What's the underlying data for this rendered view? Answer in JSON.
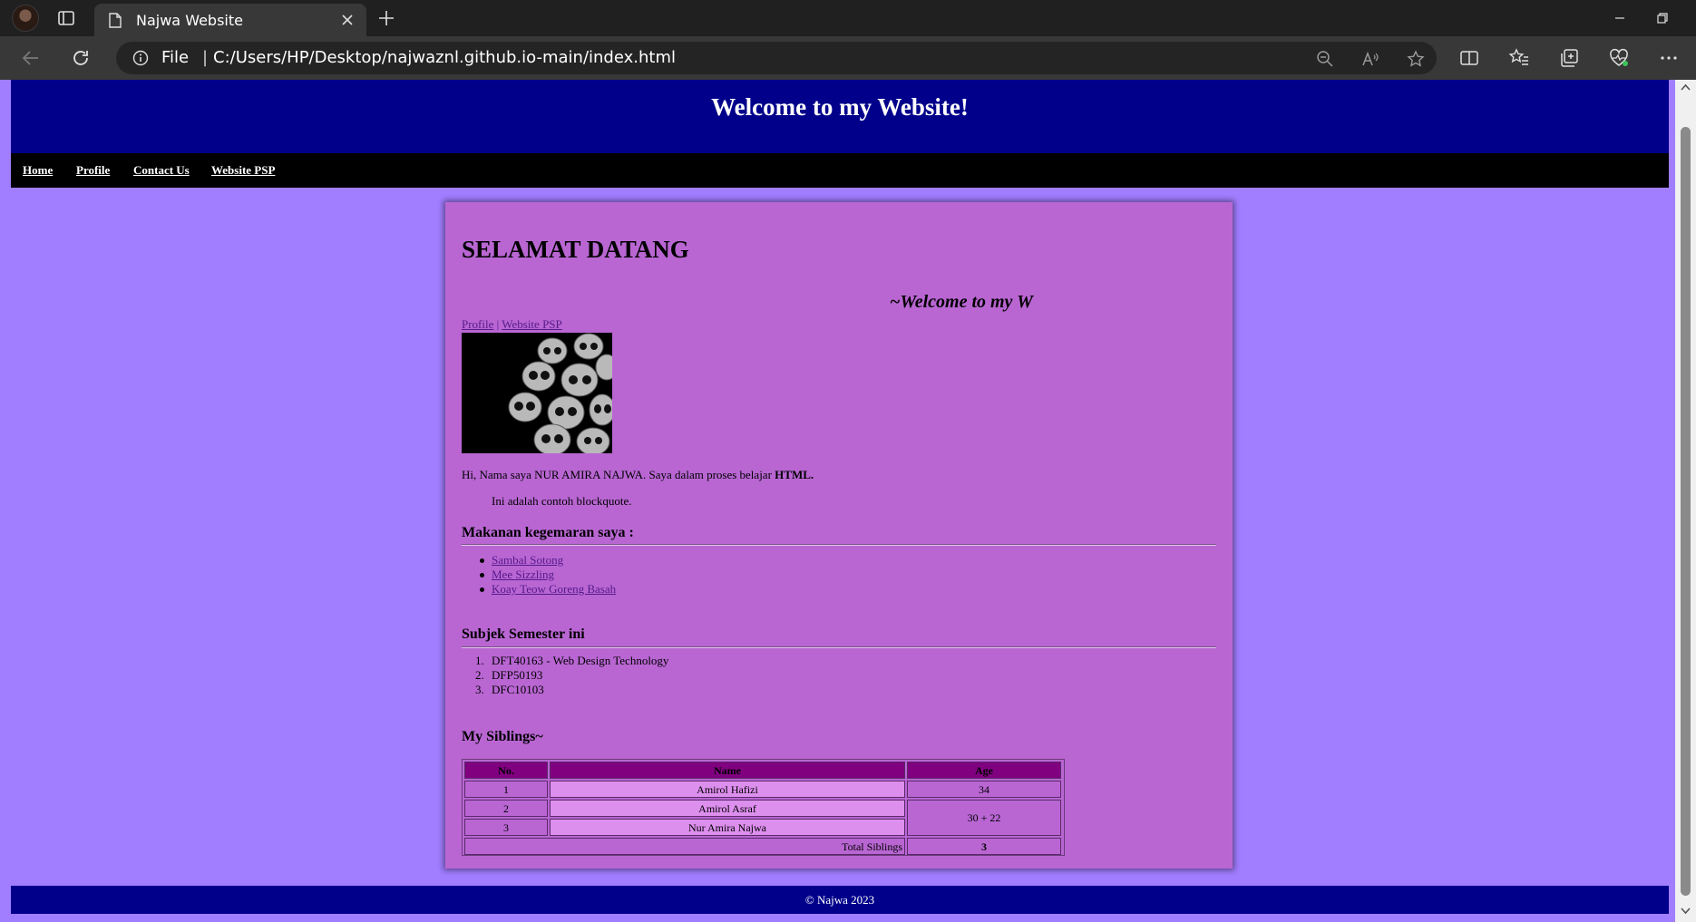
{
  "browser": {
    "tab_title": "Najwa Website",
    "address_scheme_label": "File",
    "address_separator": "|",
    "url": "C:/Users/HP/Desktop/najwaznl.github.io-main/index.html"
  },
  "site": {
    "header_title": "Welcome to my Website!",
    "nav": [
      "Home",
      "Profile",
      "Contact Us",
      "Website PSP"
    ],
    "footer": "© Najwa 2023"
  },
  "content": {
    "heading": "SELAMAT DATANG",
    "marquee": "~Welcome to my W",
    "quick_links": {
      "profile": "Profile",
      "separator": " | ",
      "website_psp": "Website PSP"
    },
    "intro_prefix": "Hi, Nama saya NUR AMIRA NAJWA. Saya dalam proses belajar ",
    "intro_bold": "HTML.",
    "blockquote": "Ini adalah contoh blockquote.",
    "food_heading": "Makanan kegemaran saya :",
    "foods": [
      "Sambal Sotong",
      "Mee Sizzling",
      "Koay Teow Goreng Basah"
    ],
    "subject_heading": "Subjek Semester ini",
    "subjects": [
      "DFT40163 - Web Design Technology",
      "DFP50193",
      "DFC10103"
    ],
    "siblings_heading": "My Siblings~",
    "table": {
      "headers": [
        "No.",
        "Name",
        "Age"
      ],
      "rows": [
        {
          "no": "1",
          "name": "Amirol Hafizi",
          "age": "34"
        },
        {
          "no": "2",
          "name": "Amirol Asraf",
          "age": "30 + 22"
        },
        {
          "no": "3",
          "name": "Nur Amira Najwa"
        }
      ],
      "total_label": "Total Siblings",
      "total_value": "3"
    }
  },
  "colors": {
    "page_bg": "#a17dff",
    "header_bg": "#00008b",
    "nav_bg": "#000000",
    "content_bg": "#b966d3",
    "table_header_bg": "#800080",
    "table_highlight_bg": "#dd8fee"
  },
  "icons": {
    "tab_actions": "tab-actions-icon",
    "page": "page-icon",
    "close": "close-icon",
    "new_tab": "plus-icon",
    "back": "back-arrow-icon",
    "refresh": "refresh-icon",
    "info": "info-icon",
    "zoom": "zoom-out-icon",
    "read_aloud": "read-aloud-icon",
    "favorite": "star-icon",
    "split": "split-screen-icon",
    "favorites": "favorites-list-icon",
    "collections": "collections-icon",
    "performance": "heart-pulse-icon",
    "more": "more-dots-icon"
  }
}
